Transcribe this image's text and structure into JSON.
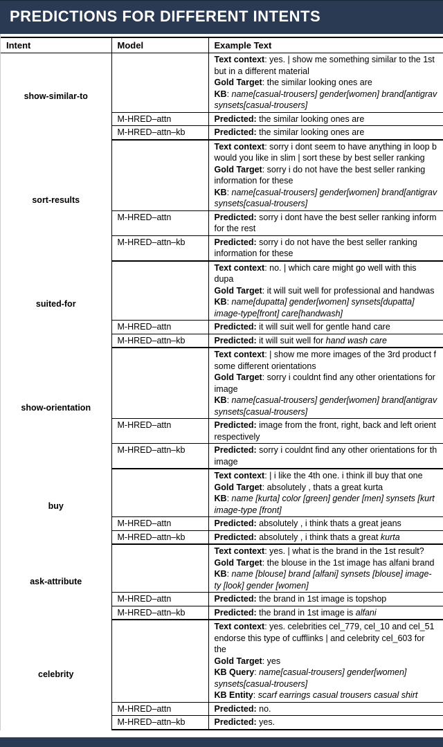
{
  "banner": "PREDICTIONS FOR DIFFERENT INTENTS",
  "headers": {
    "intent": "Intent",
    "model": "Model",
    "text": "Example Text"
  },
  "labels": {
    "textcontext": "Text context",
    "goldtarget": "Gold Target",
    "kb": "KB",
    "kbquery": "KB Query",
    "kbentity": "KB Entity",
    "predicted": "Predicted"
  },
  "models": {
    "attn": "M-HRED–attn",
    "attnkb": "M-HRED–attn–kb"
  },
  "sections": [
    {
      "intent": "show-similar-to",
      "context": [
        {
          "label": "textcontext",
          "plain": ": yes. | show me something similar to the 1st but in a different material"
        },
        {
          "label": "goldtarget",
          "plain": ": the similar looking ones are"
        },
        {
          "label": "kb",
          "plain": ": ",
          "italic": "name[casual-trousers] gender[women] brand[antigrav synsets[casual-trousers]"
        }
      ],
      "preds": [
        {
          "model": "attn",
          "plain": " the similar looking ones are"
        },
        {
          "model": "attnkb",
          "plain": " the similar looking ones are"
        }
      ]
    },
    {
      "intent": "sort-results",
      "context": [
        {
          "label": "textcontext",
          "plain": ": sorry i dont seem to have anything in loop b would you like in slim | sort these by best seller ranking"
        },
        {
          "label": "goldtarget",
          "plain": ": sorry i do not have the best seller ranking information for these"
        },
        {
          "label": "kb",
          "plain": ": ",
          "italic": "name[casual-trousers] gender[women] brand[antigrav synsets[casual-trousers]"
        }
      ],
      "preds": [
        {
          "model": "attn",
          "plain": " sorry i dont have the best seller ranking inform for the rest"
        },
        {
          "model": "attnkb",
          "plain": " sorry i do not have the best seller ranking information for these"
        }
      ]
    },
    {
      "intent": "suited-for",
      "context": [
        {
          "label": "textcontext",
          "plain": ": no. | which care might go well with this dupa"
        },
        {
          "label": "goldtarget",
          "plain": ": it will suit well for professional and handwas"
        },
        {
          "label": "kb",
          "plain": ": ",
          "italic": "name[dupatta] gender[women] synsets[dupatta] image-type[front] care[handwash]"
        }
      ],
      "preds": [
        {
          "model": "attn",
          "plain": " it will suit well for gentle hand care"
        },
        {
          "model": "attnkb",
          "plain": " it will suit well for ",
          "italic": "hand wash care"
        }
      ]
    },
    {
      "intent": "show-orientation",
      "context": [
        {
          "label": "textcontext",
          "plain": ": | show me more images of the 3rd product f some different orientations"
        },
        {
          "label": "goldtarget",
          "plain": ": sorry i couldnt find any other orientations for image"
        },
        {
          "label": "kb",
          "plain": ": ",
          "italic": "name[casual-trousers] gender[women] brand[antigrav synsets[casual-trousers]"
        }
      ],
      "preds": [
        {
          "model": "attn",
          "plain": " image from the front, right, back and left orient respectively"
        },
        {
          "model": "attnkb",
          "plain": " sorry i couldnt find any other orientations for th image"
        }
      ]
    },
    {
      "intent": "buy",
      "context": [
        {
          "label": "textcontext",
          "plain": ": | i like the 4th one. i think ill buy that one"
        },
        {
          "label": "goldtarget",
          "plain": ": absolutely , thats a great kurta"
        },
        {
          "label": "kb",
          "plain": ": ",
          "italic": "name [kurta] color [green] gender [men] synsets [kurt image-type [front]"
        }
      ],
      "preds": [
        {
          "model": "attn",
          "plain": " absolutely , i think thats a great jeans"
        },
        {
          "model": "attnkb",
          "plain": " absolutely , i think thats a great ",
          "italic": "kurta"
        }
      ]
    },
    {
      "intent": "ask-attribute",
      "context": [
        {
          "label": "textcontext",
          "plain": ": yes. | what is the brand in the 1st result?"
        },
        {
          "label": "goldtarget",
          "plain": ": the blouse in the 1st image has alfani brand"
        },
        {
          "label": "kb",
          "plain": ": ",
          "italic": "name [blouse] brand [alfani] synsets [blouse] image-ty [look] gender [women]"
        }
      ],
      "preds": [
        {
          "model": "attn",
          "plain": " the brand in 1st image is topshop"
        },
        {
          "model": "attnkb",
          "plain": " the brand in 1st image is ",
          "italic": "alfani"
        }
      ]
    },
    {
      "intent": "celebrity",
      "context": [
        {
          "label": "textcontext",
          "plain": ": yes. celebrities cel_779, cel_10 and cel_51 endorse this type of cufflinks | and celebrity cel_603 for the"
        },
        {
          "label": "goldtarget",
          "plain": ": yes"
        },
        {
          "label": "kbquery",
          "plain": ": ",
          "italic": "name[casual-trousers] gender[women] synsets[casual-trousers]"
        },
        {
          "label": "kbentity",
          "plain": ": ",
          "italic": "scarf earrings casual trousers casual shirt"
        }
      ],
      "preds": [
        {
          "model": "attn",
          "plain": " no."
        },
        {
          "model": "attnkb",
          "plain": " yes."
        }
      ]
    }
  ]
}
